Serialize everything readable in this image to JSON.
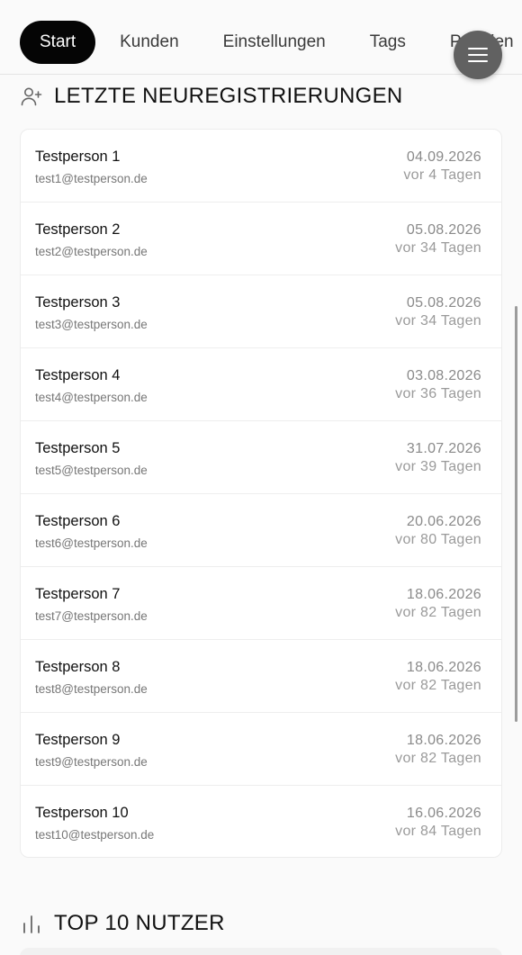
{
  "nav": {
    "tabs": [
      {
        "label": "Start",
        "active": true
      },
      {
        "label": "Kunden",
        "active": false
      },
      {
        "label": "Einstellungen",
        "active": false
      },
      {
        "label": "Tags",
        "active": false
      },
      {
        "label": "Prämien",
        "active": false
      }
    ],
    "menu_icon": "hamburger-icon"
  },
  "registrations": {
    "icon": "user-plus-icon",
    "title": "LETZTE NEUREGISTRIERUNGEN",
    "items": [
      {
        "name": "Testperson 1",
        "email": "test1@testperson.de",
        "date": "04.09.2026",
        "ago": "vor 4 Tagen"
      },
      {
        "name": "Testperson 2",
        "email": "test2@testperson.de",
        "date": "05.08.2026",
        "ago": "vor 34 Tagen"
      },
      {
        "name": "Testperson 3",
        "email": "test3@testperson.de",
        "date": "05.08.2026",
        "ago": "vor 34 Tagen"
      },
      {
        "name": "Testperson 4",
        "email": "test4@testperson.de",
        "date": "03.08.2026",
        "ago": "vor 36 Tagen"
      },
      {
        "name": "Testperson 5",
        "email": "test5@testperson.de",
        "date": "31.07.2026",
        "ago": "vor 39 Tagen"
      },
      {
        "name": "Testperson 6",
        "email": "test6@testperson.de",
        "date": "20.06.2026",
        "ago": "vor 80 Tagen"
      },
      {
        "name": "Testperson 7",
        "email": "test7@testperson.de",
        "date": "18.06.2026",
        "ago": "vor 82 Tagen"
      },
      {
        "name": "Testperson 8",
        "email": "test8@testperson.de",
        "date": "18.06.2026",
        "ago": "vor 82 Tagen"
      },
      {
        "name": "Testperson 9",
        "email": "test9@testperson.de",
        "date": "18.06.2026",
        "ago": "vor 82 Tagen"
      },
      {
        "name": "Testperson 10",
        "email": "test10@testperson.de",
        "date": "16.06.2026",
        "ago": "vor 84 Tagen"
      }
    ]
  },
  "top_users": {
    "icon": "bar-chart-icon",
    "title": "TOP 10 NUTZER"
  },
  "colors": {
    "active_tab_bg": "#050505",
    "menu_button_bg": "#616161",
    "page_bg": "#fafafa"
  }
}
